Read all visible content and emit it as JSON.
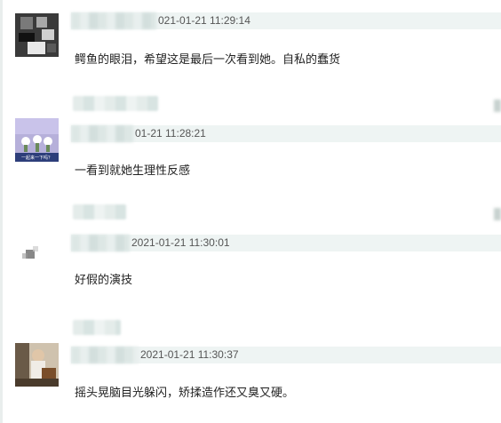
{
  "comments": [
    {
      "timestamp": "021-01-21 11:29:14",
      "text": "鳄鱼的眼泪，希望这是最后一次看到她。自私的蠢货"
    },
    {
      "timestamp": "01-21 11:28:21",
      "text": "一看到就她生理性反感",
      "avatar_caption": "一起来一下吗？"
    },
    {
      "timestamp": "2021-01-21 11:30:01",
      "text": "好假的演技"
    },
    {
      "timestamp": "2021-01-21 11:30:37",
      "text": "摇头晃脑目光躲闪，矫揉造作还又臭又硬。"
    }
  ]
}
